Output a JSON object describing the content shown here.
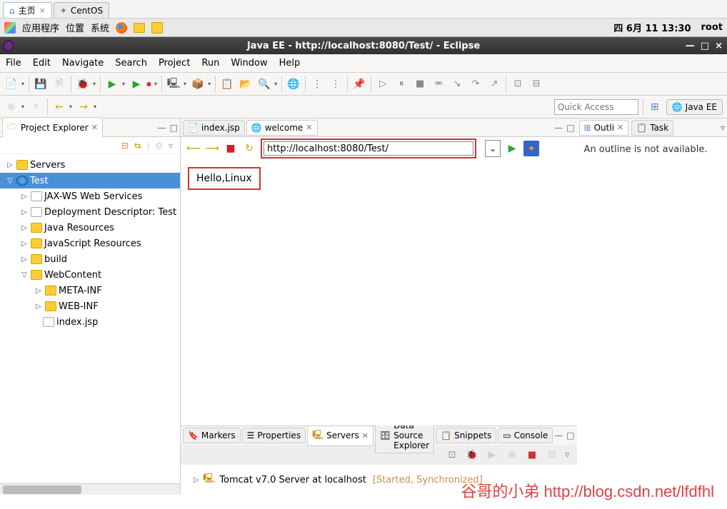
{
  "browser": {
    "tabs": [
      {
        "icon": "home-icon",
        "label": "主页"
      },
      {
        "icon": "centos-icon",
        "label": "CentOS"
      }
    ]
  },
  "gnome": {
    "apps": "应用程序",
    "places": "位置",
    "system": "系统",
    "datetime": "四 6月 11 13:30",
    "user": "root"
  },
  "eclipse": {
    "title": "Java EE - http://localhost:8080/Test/ - Eclipse",
    "menu": [
      "File",
      "Edit",
      "Navigate",
      "Search",
      "Project",
      "Run",
      "Window",
      "Help"
    ],
    "quick_access_placeholder": "Quick Access",
    "perspective": "Java EE"
  },
  "project_explorer": {
    "title": "Project Explorer",
    "tree": {
      "servers": "Servers",
      "test": "Test",
      "jaxws": "JAX-WS Web Services",
      "dd": "Deployment Descriptor: Test",
      "jres": "Java Resources",
      "jsres": "JavaScript Resources",
      "build": "build",
      "webcontent": "WebContent",
      "metainf": "META-INF",
      "webinf": "WEB-INF",
      "indexjsp": "index.jsp"
    }
  },
  "editor": {
    "tabs": [
      {
        "icon": "jsp-icon",
        "label": "index.jsp",
        "active": false
      },
      {
        "icon": "globe-icon",
        "label": "welcome",
        "active": true
      }
    ],
    "url": "http://localhost:8080/Test/",
    "content": "Hello,Linux"
  },
  "outline": {
    "tab1": "Outli",
    "tab2": "Task",
    "message": "An outline is not available."
  },
  "bottom": {
    "tabs": [
      "Markers",
      "Properties",
      "Servers",
      "Data Source Explorer",
      "Snippets",
      "Console"
    ],
    "server_name": "Tomcat v7.0 Server at localhost",
    "server_status": "[Started, Synchronized]"
  },
  "watermark": "谷哥的小弟 http://blog.csdn.net/lfdfhl"
}
